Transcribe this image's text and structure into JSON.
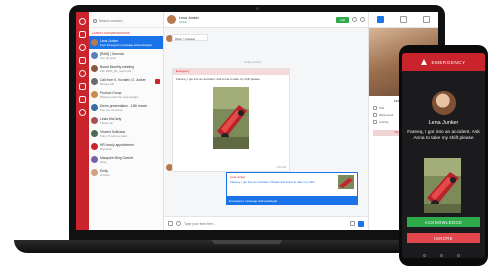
{
  "contacts_panel": {
    "search_placeholder": "Search contact...",
    "section_label": "Latest conversations",
    "items": [
      {
        "name": "Lena Junker",
        "message": "Fwd: Emergency message acknowledged",
        "avatar_color": "#b7794f",
        "active": true,
        "unread": false
      },
      {
        "name": "[RAM] | General",
        "message": "Yes, all good",
        "avatar_color": "#5a7fbf",
        "active": false,
        "unread": false
      },
      {
        "name": "Board Monthly meeting",
        "message": "File: 2020_Q1_report.pdf",
        "avatar_color": "#8a5a3c",
        "active": false,
        "unread": false
      },
      {
        "name": "Call from K. Kovalev, G. Junker",
        "message": "Missed call",
        "avatar_color": "#6b6b6b",
        "active": false,
        "unread": true
      },
      {
        "name": "Product Group",
        "message": "Please review the new designs",
        "avatar_color": "#c98c4a",
        "active": false,
        "unread": false
      },
      {
        "name": "Demo presentation - 12th march",
        "message": "See you tomorrow",
        "avatar_color": "#3a6ea5",
        "active": false,
        "unread": false
      },
      {
        "name": "Linda McCarty",
        "message": "Thank you",
        "avatar_color": "#a85050",
        "active": false,
        "unread": false
      },
      {
        "name": "Vincent Sullivans",
        "message": "Sure, I'll call you back",
        "avatar_color": "#4f6b4f",
        "active": false,
        "unread": false
      },
      {
        "name": "HR hourly appointment",
        "message": "Reminder",
        "avatar_color": "#c9232b",
        "active": false,
        "unread": false
      },
      {
        "name": "Macquire Ming Garrett",
        "message": "Okay",
        "avatar_color": "#7b5fa8",
        "active": false,
        "unread": false
      },
      {
        "name": "Emily",
        "message": "Hi there",
        "avatar_color": "#d0a080",
        "active": false,
        "unread": false
      }
    ]
  },
  "chat": {
    "contact_name": "Lena Junker",
    "contact_status": "Online",
    "call_label": "Call",
    "first_bubble": "Okay > thanks!",
    "date_separator": "Today at 9:42",
    "emergency_label": "Emergency",
    "emergency_text": "Fareeq, I got into an accident. Ask Anna to take my shift please",
    "emergency_time": "9:42 AM",
    "reply_quote": "Lena Junker",
    "reply_text": "Fareeq, I got into an accident. Please ask Anna to take my shift!",
    "reply_status": "Emergency message acknowledged",
    "composer_placeholder": "Type your text here..."
  },
  "profile": {
    "name": "Lena Junker",
    "rows": [
      "Title",
      "Work email",
      "Country"
    ],
    "button": "Remove Profile"
  },
  "phone": {
    "header": "EMERGENCY",
    "name": "Lena Junker",
    "message": "Fareeq, I got into an accident. Ask Anna to take my shift please",
    "acknowledge": "ACKNOWLEDGE",
    "ignore": "IGNORE"
  },
  "colors": {
    "brand_red": "#c9232b",
    "accent_blue": "#1a73e8",
    "ack_green": "#2eaa4a"
  }
}
